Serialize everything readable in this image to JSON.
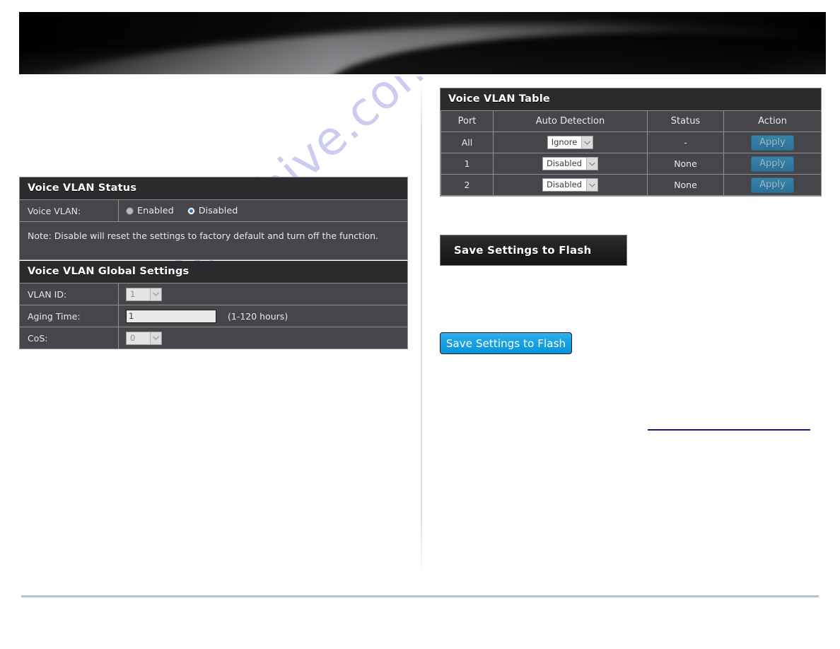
{
  "watermark": {
    "text": "manualshive.com"
  },
  "banner": {
    "name": "product-banner"
  },
  "left_column": {
    "status_panel": {
      "title": "Voice VLAN Status",
      "field_label": "Voice VLAN:",
      "options": [
        {
          "label": "Enabled",
          "selected": false
        },
        {
          "label": "Disabled",
          "selected": true
        }
      ],
      "note": "Note: Disable will reset the settings to factory default and turn off the function."
    },
    "global_panel": {
      "title": "Voice VLAN Global Settings",
      "rows": [
        {
          "label": "VLAN ID:",
          "control": "select",
          "value": "1",
          "hint": ""
        },
        {
          "label": "Aging Time:",
          "control": "text",
          "value": "1",
          "hint": "(1-120 hours)"
        },
        {
          "label": "CoS:",
          "control": "select",
          "value": "0",
          "hint": ""
        }
      ]
    }
  },
  "right_column": {
    "table_panel": {
      "title": "Voice VLAN Table",
      "columns": [
        "Port",
        "Auto Detection",
        "Status",
        "Action"
      ],
      "rows": [
        {
          "port": "All",
          "auto_detection": "Ignore",
          "status": "-",
          "action": "Apply"
        },
        {
          "port": "1",
          "auto_detection": "Disabled",
          "status": "None",
          "action": "Apply"
        },
        {
          "port": "2",
          "auto_detection": "Disabled",
          "status": "None",
          "action": "Apply"
        }
      ]
    },
    "save_dark_button": "Save Settings to Flash",
    "save_blue_button": "Save Settings to Flash"
  },
  "colors": {
    "panel_bg": "#45454a",
    "panel_header": "#2b2b2d",
    "panel_border": "#8e8e90",
    "accent_blue": "#19a3e6",
    "apply_blue": "#337ba4",
    "rule_blue": "#a8c6dd",
    "link_blue": "#151a8c",
    "watermark": "#c9caf0"
  }
}
